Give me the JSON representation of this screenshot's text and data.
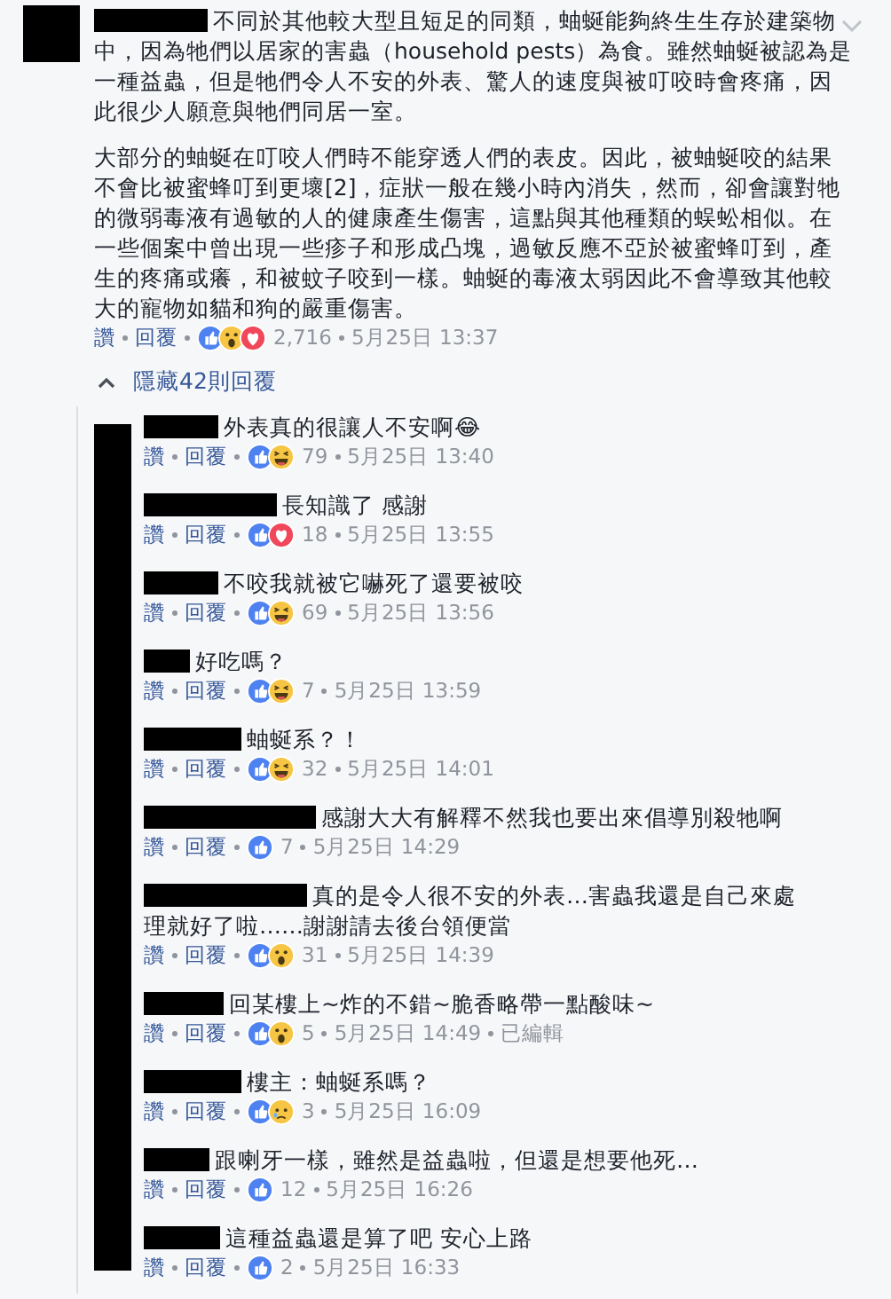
{
  "comment": {
    "paragraphs": [
      [
        "不同於其他較大型且短足的同類，蚰蜒能夠終生生存於建築物",
        "中，因為牠們以居家的害蟲（household pests）為食。雖然蚰蜒被認為是",
        "一種益蟲，但是牠們令人不安的外表、驚人的速度與被叮咬時會疼痛，因",
        "此很少人願意與牠們同居一室。"
      ],
      [
        "大部分的蚰蜒在叮咬人們時不能穿透人們的表皮。因此，被蚰蜒咬的結果",
        "不會比被蜜蜂叮到更壞[2]，症狀一般在幾小時內消失，然而，卻會讓對牠",
        "的微弱毒液有過敏的人的健康產生傷害，這點與其他種類的蜈蚣相似。在",
        "一些個案中曾出現一些疹子和形成凸塊，過敏反應不亞於被蜜蜂叮到，產",
        "生的疼痛或癢，和被蚊子咬到一樣。蚰蜒的毒液太弱因此不會導致其他較",
        "大的寵物如貓和狗的嚴重傷害。"
      ]
    ],
    "like": "讚",
    "reply": "回覆",
    "reactions": [
      {
        "kind": "like"
      },
      {
        "kind": "wow"
      },
      {
        "kind": "love"
      }
    ],
    "count": "2,716",
    "time": "5月25日 13:37"
  },
  "hide_replies": "隱藏42則回覆",
  "replies": [
    {
      "lines": [
        "外表真的很讓人不安啊😂"
      ],
      "like": "讚",
      "reply": "回覆",
      "reactions": [
        {
          "kind": "like"
        },
        {
          "kind": "haha"
        }
      ],
      "count": "79",
      "time": "5月25日 13:40"
    },
    {
      "lines": [
        "長知識了 感謝"
      ],
      "like": "讚",
      "reply": "回覆",
      "reactions": [
        {
          "kind": "like"
        },
        {
          "kind": "love"
        }
      ],
      "count": "18",
      "time": "5月25日 13:55"
    },
    {
      "lines": [
        "不咬我就被它嚇死了還要被咬"
      ],
      "like": "讚",
      "reply": "回覆",
      "reactions": [
        {
          "kind": "like"
        },
        {
          "kind": "haha"
        }
      ],
      "count": "69",
      "time": "5月25日 13:56"
    },
    {
      "lines": [
        "好吃嗎？"
      ],
      "like": "讚",
      "reply": "回覆",
      "reactions": [
        {
          "kind": "like"
        },
        {
          "kind": "haha"
        }
      ],
      "count": "7",
      "time": "5月25日 13:59"
    },
    {
      "lines": [
        "蚰蜒系？！"
      ],
      "like": "讚",
      "reply": "回覆",
      "reactions": [
        {
          "kind": "like"
        },
        {
          "kind": "haha"
        }
      ],
      "count": "32",
      "time": "5月25日 14:01"
    },
    {
      "lines": [
        "感謝大大有解釋不然我也要出來倡導別殺牠啊"
      ],
      "like": "讚",
      "reply": "回覆",
      "reactions": [
        {
          "kind": "like"
        }
      ],
      "count": "7",
      "time": "5月25日 14:29"
    },
    {
      "lines": [
        "真的是令人很不安的外表…害蟲我還是自己來處",
        "理就好了啦……謝謝請去後台領便當"
      ],
      "like": "讚",
      "reply": "回覆",
      "reactions": [
        {
          "kind": "like"
        },
        {
          "kind": "wow"
        }
      ],
      "count": "31",
      "time": "5月25日 14:39"
    },
    {
      "lines": [
        "回某樓上~炸的不錯~脆香略帶一點酸味~"
      ],
      "like": "讚",
      "reply": "回覆",
      "reactions": [
        {
          "kind": "like"
        },
        {
          "kind": "wow"
        }
      ],
      "count": "5",
      "time": "5月25日 14:49",
      "edited": "已編輯"
    },
    {
      "lines": [
        "樓主：蚰蜒系嗎？"
      ],
      "like": "讚",
      "reply": "回覆",
      "reactions": [
        {
          "kind": "like"
        },
        {
          "kind": "sad"
        }
      ],
      "count": "3",
      "time": "5月25日 16:09"
    },
    {
      "lines": [
        "跟喇牙一樣，雖然是益蟲啦，但還是想要他死…"
      ],
      "like": "讚",
      "reply": "回覆",
      "reactions": [
        {
          "kind": "like"
        }
      ],
      "count": "12",
      "time": "5月25日 16:26"
    },
    {
      "lines": [
        "這種益蟲還是算了吧 安心上路"
      ],
      "like": "讚",
      "reply": "回覆",
      "reactions": [
        {
          "kind": "like"
        }
      ],
      "count": "2",
      "time": "5月25日 16:33"
    }
  ]
}
